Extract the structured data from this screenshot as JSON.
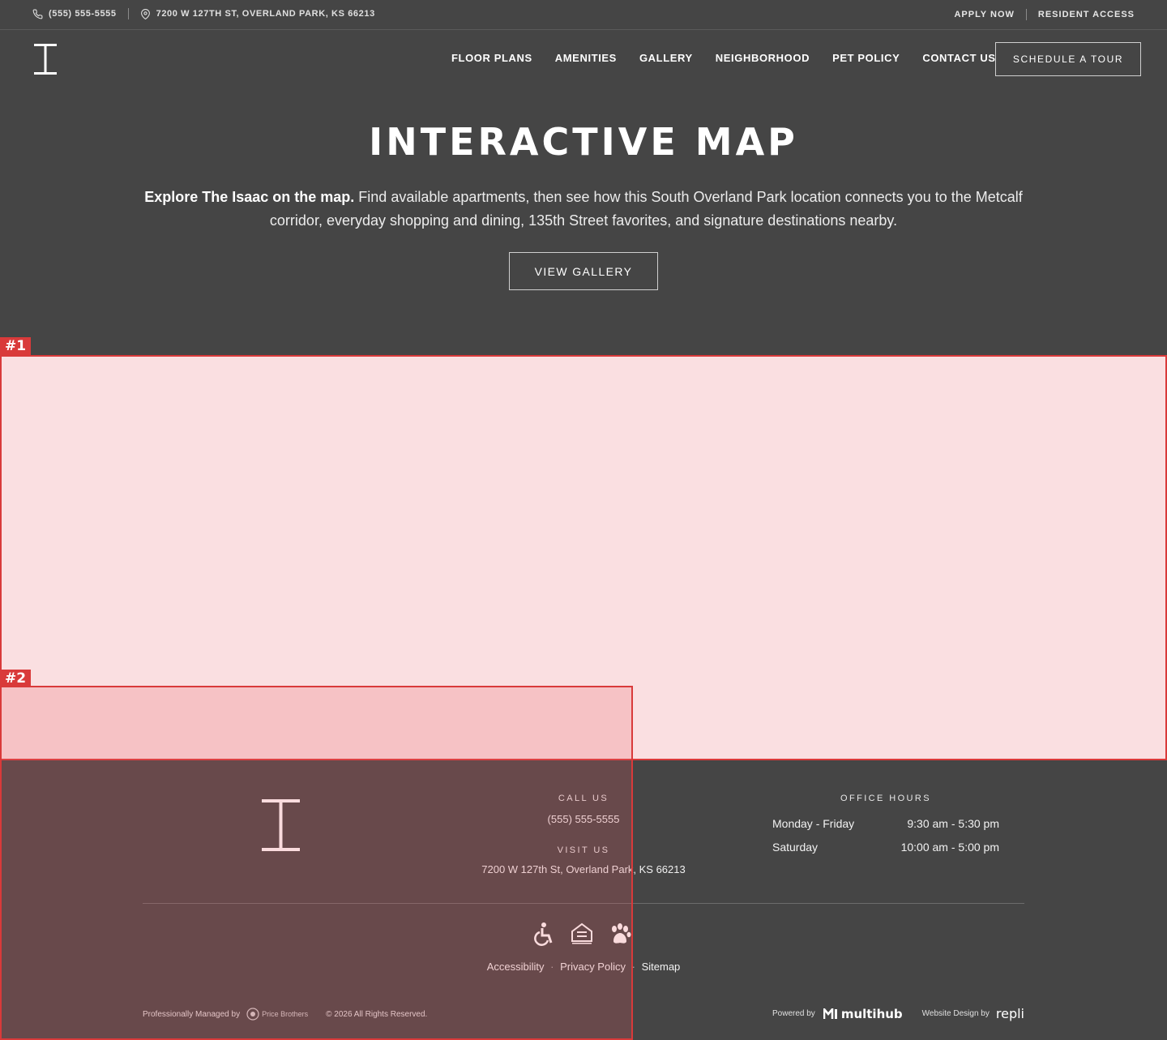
{
  "topbar": {
    "phone": "(555) 555-5555",
    "address": "7200 W 127TH ST, OVERLAND PARK, KS 66213",
    "apply": "APPLY NOW",
    "resident": "RESIDENT ACCESS"
  },
  "nav": {
    "items": [
      "FLOOR PLANS",
      "AMENITIES",
      "GALLERY",
      "NEIGHBORHOOD",
      "PET POLICY",
      "CONTACT US"
    ],
    "cta": "SCHEDULE A TOUR"
  },
  "hero": {
    "title": "INTERACTIVE MAP",
    "lead": "Explore The Isaac on the map.",
    "desc": " Find available apartments, then see how this South Overland Park location connects you to the Metcalf corridor, everyday shopping and dining, 135th Street favorites, and signature destinations nearby.",
    "button": "VIEW GALLERY"
  },
  "annotations": {
    "map_tag": "#1",
    "overlay_tag": "#2"
  },
  "footer": {
    "call_label": "CALL US",
    "phone": "(555) 555-5555",
    "visit_label": "VISIT US",
    "address": "7200 W 127th St, Overland Park, KS 66213",
    "hours_label": "OFFICE HOURS",
    "hours": [
      {
        "days": "Monday - Friday",
        "time": "9:30 am - 5:30 pm"
      },
      {
        "days": "Saturday",
        "time": "10:00 am - 5:00 pm"
      }
    ],
    "icons": [
      "accessibility-icon",
      "equal-housing-icon",
      "pet-paw-icon"
    ],
    "legal": [
      "Accessibility",
      "Privacy Policy",
      "Sitemap"
    ],
    "managed_by": "Professionally Managed by",
    "manager": "Price Brothers",
    "copyright": "© 2026 All Rights Reserved.",
    "powered_by": "Powered by",
    "platform": "multihub",
    "design_by": "Website Design by",
    "designer": "repli"
  },
  "colors": {
    "background": "#454545",
    "map": "#fadfe1",
    "annotation": "#d93a3a"
  }
}
